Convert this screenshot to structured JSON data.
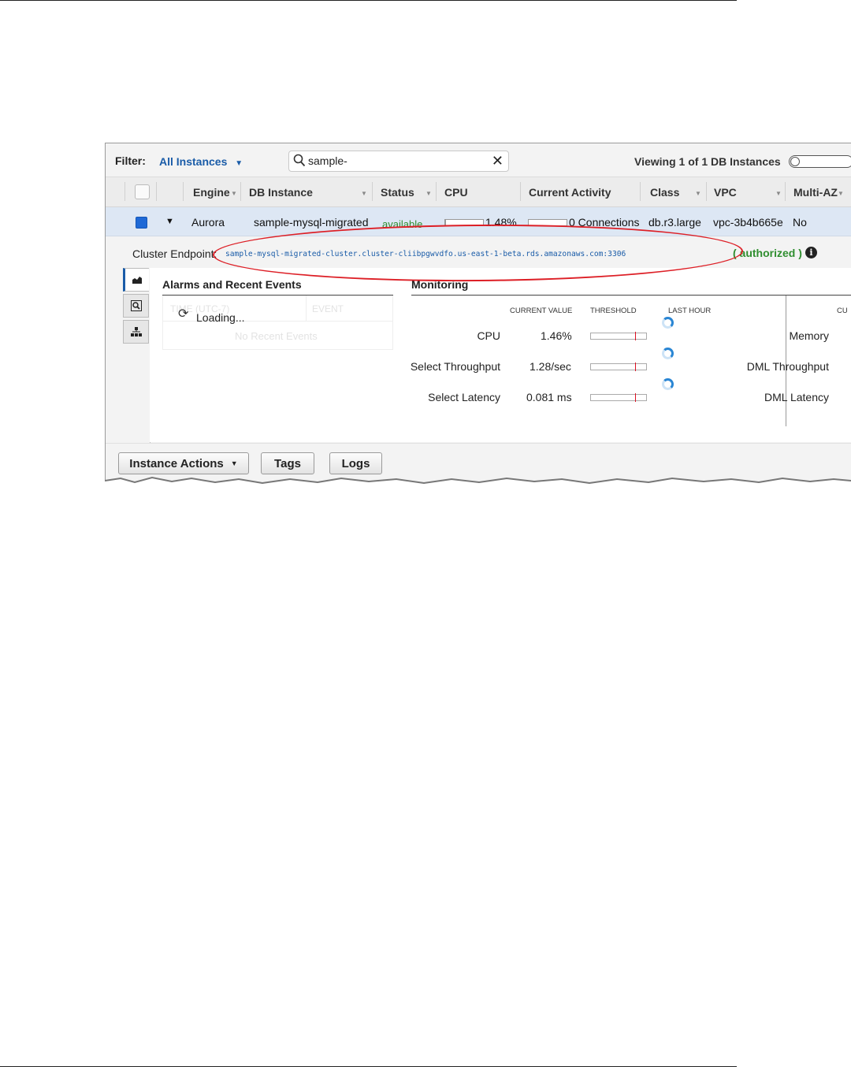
{
  "filter": {
    "label": "Filter:",
    "selected": "All Instances",
    "search_value": "sample-",
    "viewing": "Viewing 1 of 1 DB Instances"
  },
  "columns": [
    "Engine",
    "DB Instance",
    "Status",
    "CPU",
    "Current Activity",
    "Class",
    "VPC",
    "Multi-AZ"
  ],
  "row": {
    "engine": "Aurora",
    "db_instance": "sample-mysql-migrated",
    "status": "available",
    "cpu": "1.48%",
    "activity": "0 Connections",
    "class": "db.r3.large",
    "vpc": "vpc-3b4b665e",
    "multi_az": "No"
  },
  "cluster": {
    "label": "Cluster Endpoint:",
    "endpoint": "sample-mysql-migrated-cluster.cluster-cliibpgwvdfo.us-east-1-beta.rds.amazonaws.com:3306",
    "auth": "( authorized )"
  },
  "alarms": {
    "title": "Alarms and Recent Events",
    "loading": "Loading...",
    "ghost_time": "TIME (UTC-7)",
    "ghost_event": "EVENT",
    "ghost_empty": "No Recent Events"
  },
  "monitoring": {
    "title": "Monitoring",
    "headers": [
      "CURRENT VALUE",
      "THRESHOLD",
      "LAST HOUR"
    ],
    "right_header": "CU",
    "metrics": [
      {
        "label": "CPU",
        "value": "1.46%"
      },
      {
        "label": "Select Throughput",
        "value": "1.28/sec"
      },
      {
        "label": "Select Latency",
        "value": "0.081 ms"
      }
    ],
    "right_metrics": [
      "Memory",
      "DML Throughput",
      "DML Latency"
    ]
  },
  "buttons": {
    "instance_actions": "Instance Actions",
    "tags": "Tags",
    "logs": "Logs"
  },
  "colors": {
    "link": "#1a5ca8",
    "status_ok": "#2f8e2f",
    "highlight_oval": "#dd1f26",
    "row_selected": "#dde7f4"
  },
  "progress": {
    "cpu_bar_fill": 0.015,
    "activity_bar_fill": 0.0
  }
}
